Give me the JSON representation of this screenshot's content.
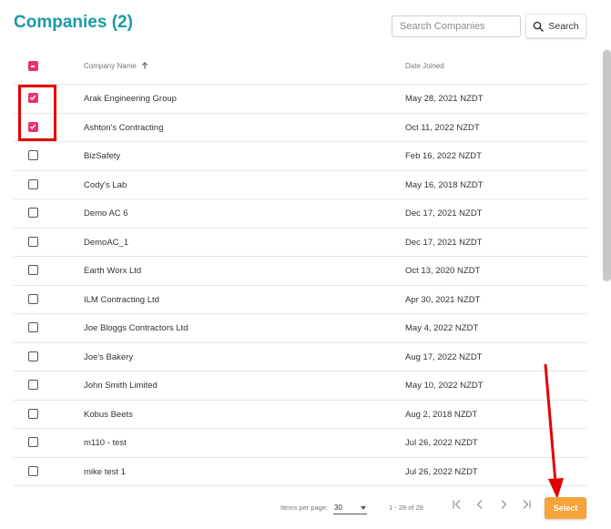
{
  "header": {
    "title": "Companies (2)",
    "search_placeholder": "Search Companies",
    "search_button": "Search"
  },
  "table": {
    "columns": {
      "name": "Company Name",
      "date": "Date Joined"
    },
    "rows": [
      {
        "name": "Arak Engineering Group",
        "date": "May 28, 2021 NZDT",
        "checked": true
      },
      {
        "name": "Ashton's Contracting",
        "date": "Oct 11, 2022 NZDT",
        "checked": true
      },
      {
        "name": "BizSafety",
        "date": "Feb 16, 2022 NZDT",
        "checked": false
      },
      {
        "name": "Cody's Lab",
        "date": "May 16, 2018 NZDT",
        "checked": false
      },
      {
        "name": "Demo AC 6",
        "date": "Dec 17, 2021 NZDT",
        "checked": false
      },
      {
        "name": "DemoAC_1",
        "date": "Dec 17, 2021 NZDT",
        "checked": false
      },
      {
        "name": "Earth Worx Ltd",
        "date": "Oct 13, 2020 NZDT",
        "checked": false
      },
      {
        "name": "ILM Contracting Ltd",
        "date": "Apr 30, 2021 NZDT",
        "checked": false
      },
      {
        "name": "Joe Bloggs Contractors Ltd",
        "date": "May 4, 2022 NZDT",
        "checked": false
      },
      {
        "name": "Joe's Bakery",
        "date": "Aug 17, 2022 NZDT",
        "checked": false
      },
      {
        "name": "John Smith Limited",
        "date": "May 10, 2022 NZDT",
        "checked": false
      },
      {
        "name": "Kobus Beets",
        "date": "Aug 2, 2018 NZDT",
        "checked": false
      },
      {
        "name": "m110 - test",
        "date": "Jul 26, 2022 NZDT",
        "checked": false
      },
      {
        "name": "mike test 1",
        "date": "Jul 26, 2022 NZDT",
        "checked": false
      }
    ]
  },
  "footer": {
    "items_per_page_label": "Items per page:",
    "items_per_page_value": "30",
    "range_label": "1 - 28 of 28",
    "select_button": "Select"
  },
  "colors": {
    "title": "#1a9aa6",
    "checkbox_checked": "#e8336f",
    "select_button": "#f5a33a",
    "annotation": "#e30000"
  }
}
